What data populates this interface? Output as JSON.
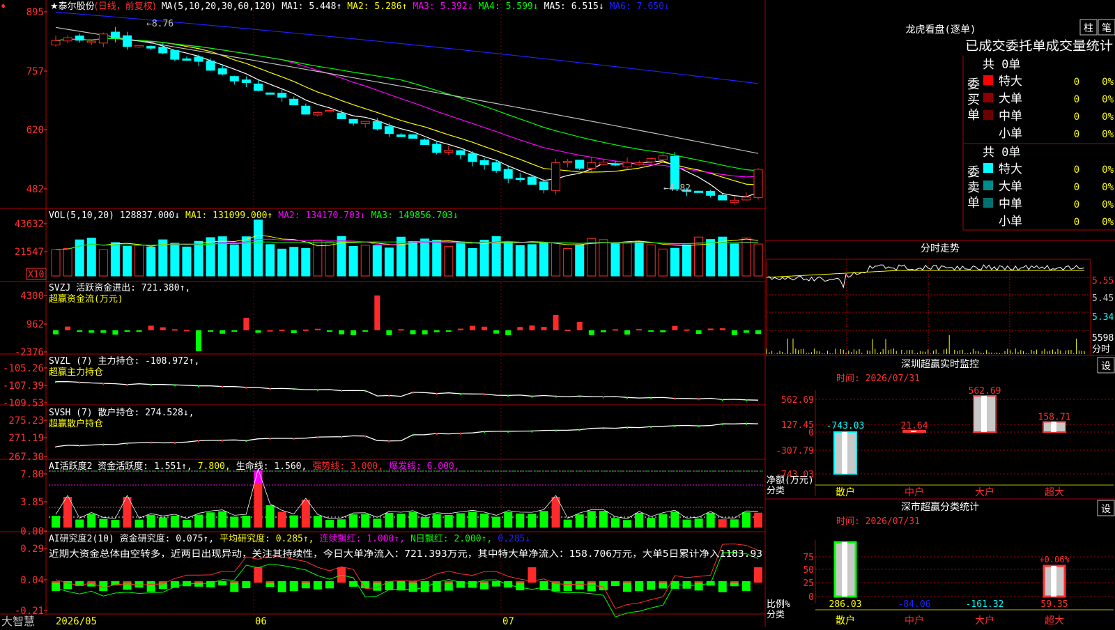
{
  "stock": {
    "name": "★泰尔股份",
    "period": "(日线，前复权)",
    "footer_brand": "大智慧",
    "dates": [
      "2026/05",
      "06",
      "07"
    ],
    "corner_mark": "♦"
  },
  "colors": {
    "up": "#ff2a2a",
    "down": "#00ffff",
    "ma5": "#ffffff",
    "ma10": "#ffff00",
    "ma20": "#ff00ff",
    "ma30": "#00ff00",
    "ma60": "#c0c0c0",
    "ma120": "#1e22ff",
    "frame": "#b00000",
    "label_yellow": "#ffff00"
  },
  "legends": {
    "price": [
      {
        "text": "MA(5,10,20,30,60,120)",
        "color": "#ffffff"
      },
      {
        "text": "MA1: 5.448↑",
        "color": "#ffffff"
      },
      {
        "text": "MA2: 5.286↑",
        "color": "#ffff00"
      },
      {
        "text": "MA3: 5.392↓",
        "color": "#ff00ff"
      },
      {
        "text": "MA4: 5.599↓",
        "color": "#00ff00"
      },
      {
        "text": "MA5: 6.515↓",
        "color": "#ffffff"
      },
      {
        "text": "MA6: 7.650↓",
        "color": "#1e22ff"
      }
    ],
    "vol": [
      {
        "text": "VOL(5,10,20)",
        "color": "#ffffff"
      },
      {
        "text": "128837.000↓",
        "color": "#ffffff"
      },
      {
        "text": "MA1: 131099.000↑",
        "color": "#ffff00"
      },
      {
        "text": "MA2: 134170.703↓",
        "color": "#ff00ff"
      },
      {
        "text": "MA3: 149856.703↓",
        "color": "#00ff00"
      }
    ],
    "svzj": [
      {
        "text": "SVZJ  活跃资金进出: 721.380↑,",
        "color": "#ffffff"
      }
    ],
    "svzj_sub": "超赢资金流(万元)",
    "svzl": [
      {
        "text": "SVZL (7) 主力持仓: -108.972↑,",
        "color": "#ffffff"
      }
    ],
    "svzl_sub": "超赢主力持仓",
    "svsh": [
      {
        "text": "SVSH (7) 散户持仓: 274.528↓,",
        "color": "#ffffff"
      }
    ],
    "svsh_sub": "超赢散户持仓",
    "ai1": [
      {
        "text": "AI活跃度2 资金活跃度: 1.551↑,",
        "color": "#ffffff"
      },
      {
        "text": "7.800,",
        "color": "#ffff00"
      },
      {
        "text": "生命线: 1.560,",
        "color": "#ffffff"
      },
      {
        "text": "强势线: 3.000,",
        "color": "#ff2a2a"
      },
      {
        "text": "爆发线: 6.000,",
        "color": "#ff00ff"
      }
    ],
    "ai2": [
      {
        "text": "AI研究度2(10) 资金研究度: 0.075↑,",
        "color": "#ffffff"
      },
      {
        "text": "平均研究度: 0.285↑,",
        "color": "#ffff00"
      },
      {
        "text": "连续飘红: 1.000↑,",
        "color": "#ff00ff"
      },
      {
        "text": "N日飘红: 2.000↑,",
        "color": "#00ff00"
      },
      {
        "text": "0.285↓",
        "color": "#1e22ff"
      }
    ],
    "ai2_note": "近期大资金总体由空转多，近两日出现异动，关注其持续性，今日大单净流入：721.393万元，其中特大单净流入：158.706万元，大单5日累计净入1183.93"
  },
  "axes": {
    "price": [
      "895",
      "757",
      "620",
      "482"
    ],
    "vol": [
      "43632",
      "21547"
    ],
    "vol_unit": "X10",
    "svzj": [
      "4300",
      "962",
      "-2376"
    ],
    "svzl": [
      "-105.26",
      "-107.39",
      "-109.53"
    ],
    "svsh": [
      "275.23",
      "271.19",
      "267.30"
    ],
    "ai1": [
      "7.80",
      "3.85",
      "0.00"
    ],
    "ai2": [
      "0.29",
      "0.04",
      "-0.21"
    ]
  },
  "annotations": {
    "high": "←8.76",
    "low": "←4.82"
  },
  "right": {
    "lhb_title": "龙虎看盘(逐单)",
    "lhb_btn1": "柱",
    "lhb_btn2": "笔",
    "lhb_subtitle": "已成交委托单成交量统计",
    "buy_label": "委买单",
    "sell_label": "委卖单",
    "buy_total": "共 0单",
    "sell_total": "共 0单",
    "buy_rows": [
      {
        "name": "特大",
        "count": "0",
        "pct": "0%",
        "color": "#ff0000"
      },
      {
        "name": "大单",
        "count": "0",
        "pct": "0%",
        "color": "#8b0000"
      },
      {
        "name": "中单",
        "count": "0",
        "pct": "0%",
        "color": "#6b0000"
      },
      {
        "name": "小单",
        "count": "0",
        "pct": "0%",
        "color": ""
      }
    ],
    "sell_rows": [
      {
        "name": "特大",
        "count": "0",
        "pct": "0%",
        "color": "#00ffff"
      },
      {
        "name": "大单",
        "count": "0",
        "pct": "0%",
        "color": "#008b8b"
      },
      {
        "name": "中单",
        "count": "0",
        "pct": "0%",
        "color": "#007070"
      },
      {
        "name": "小单",
        "count": "0",
        "pct": "0%",
        "color": ""
      }
    ],
    "intraday_title": "分时走势",
    "intraday_axis": [
      "5.55",
      "5.45",
      "5.34"
    ],
    "intraday_vol": [
      "5598",
      "分时"
    ],
    "monitor_title": "深圳超赢实时监控",
    "monitor_btn": "设",
    "monitor_time": "时间: 2026/07/31",
    "monitor_axis": [
      "562.69",
      "127.45",
      "0",
      "-307.79",
      "-743.03"
    ],
    "monitor_ylabel": "净额(万元)",
    "monitor_xlabel": "分类",
    "monitor_labels": [
      "-743.03",
      "21.64",
      "562.69",
      "158.71"
    ],
    "categories": [
      "散户",
      "中户",
      "大户",
      "超大"
    ],
    "stat_title": "深市超赢分类统计",
    "stat_btn": "设",
    "stat_time": "时间: 2026/07/31",
    "stat_axis": [
      "75",
      "50",
      "25",
      "0"
    ],
    "stat_ylabel": "比例%",
    "stat_xlabel": "分类",
    "stat_values": [
      "286.03",
      "-84.06",
      "-161.32",
      "59.35"
    ],
    "stat_pct_label": "+0.06%"
  },
  "chart_data": [
    {
      "type": "candlestick",
      "title": "泰尔股份 日线 前复权",
      "x": [
        "2026/05",
        "06",
        "07"
      ],
      "ylim": [
        4.7,
        9.2
      ],
      "ohlc_count": 60,
      "high_marker": 8.76,
      "low_marker": 4.82,
      "ma": {
        "MA1": 5.448,
        "MA2": 5.286,
        "MA3": 5.392,
        "MA4": 5.599,
        "MA5": 6.515,
        "MA6": 7.65
      }
    },
    {
      "type": "bar",
      "title": "VOL(5,10,20)",
      "last": 128837.0,
      "ma": {
        "MA1": 131099.0,
        "MA2": 134170.703,
        "MA3": 149856.703
      }
    },
    {
      "type": "bar",
      "title": "超赢分类统计 净额(万元)",
      "categories": [
        "散户",
        "中户",
        "大户",
        "超大"
      ],
      "values": [
        -743.03,
        21.64,
        562.69,
        158.71
      ]
    }
  ]
}
